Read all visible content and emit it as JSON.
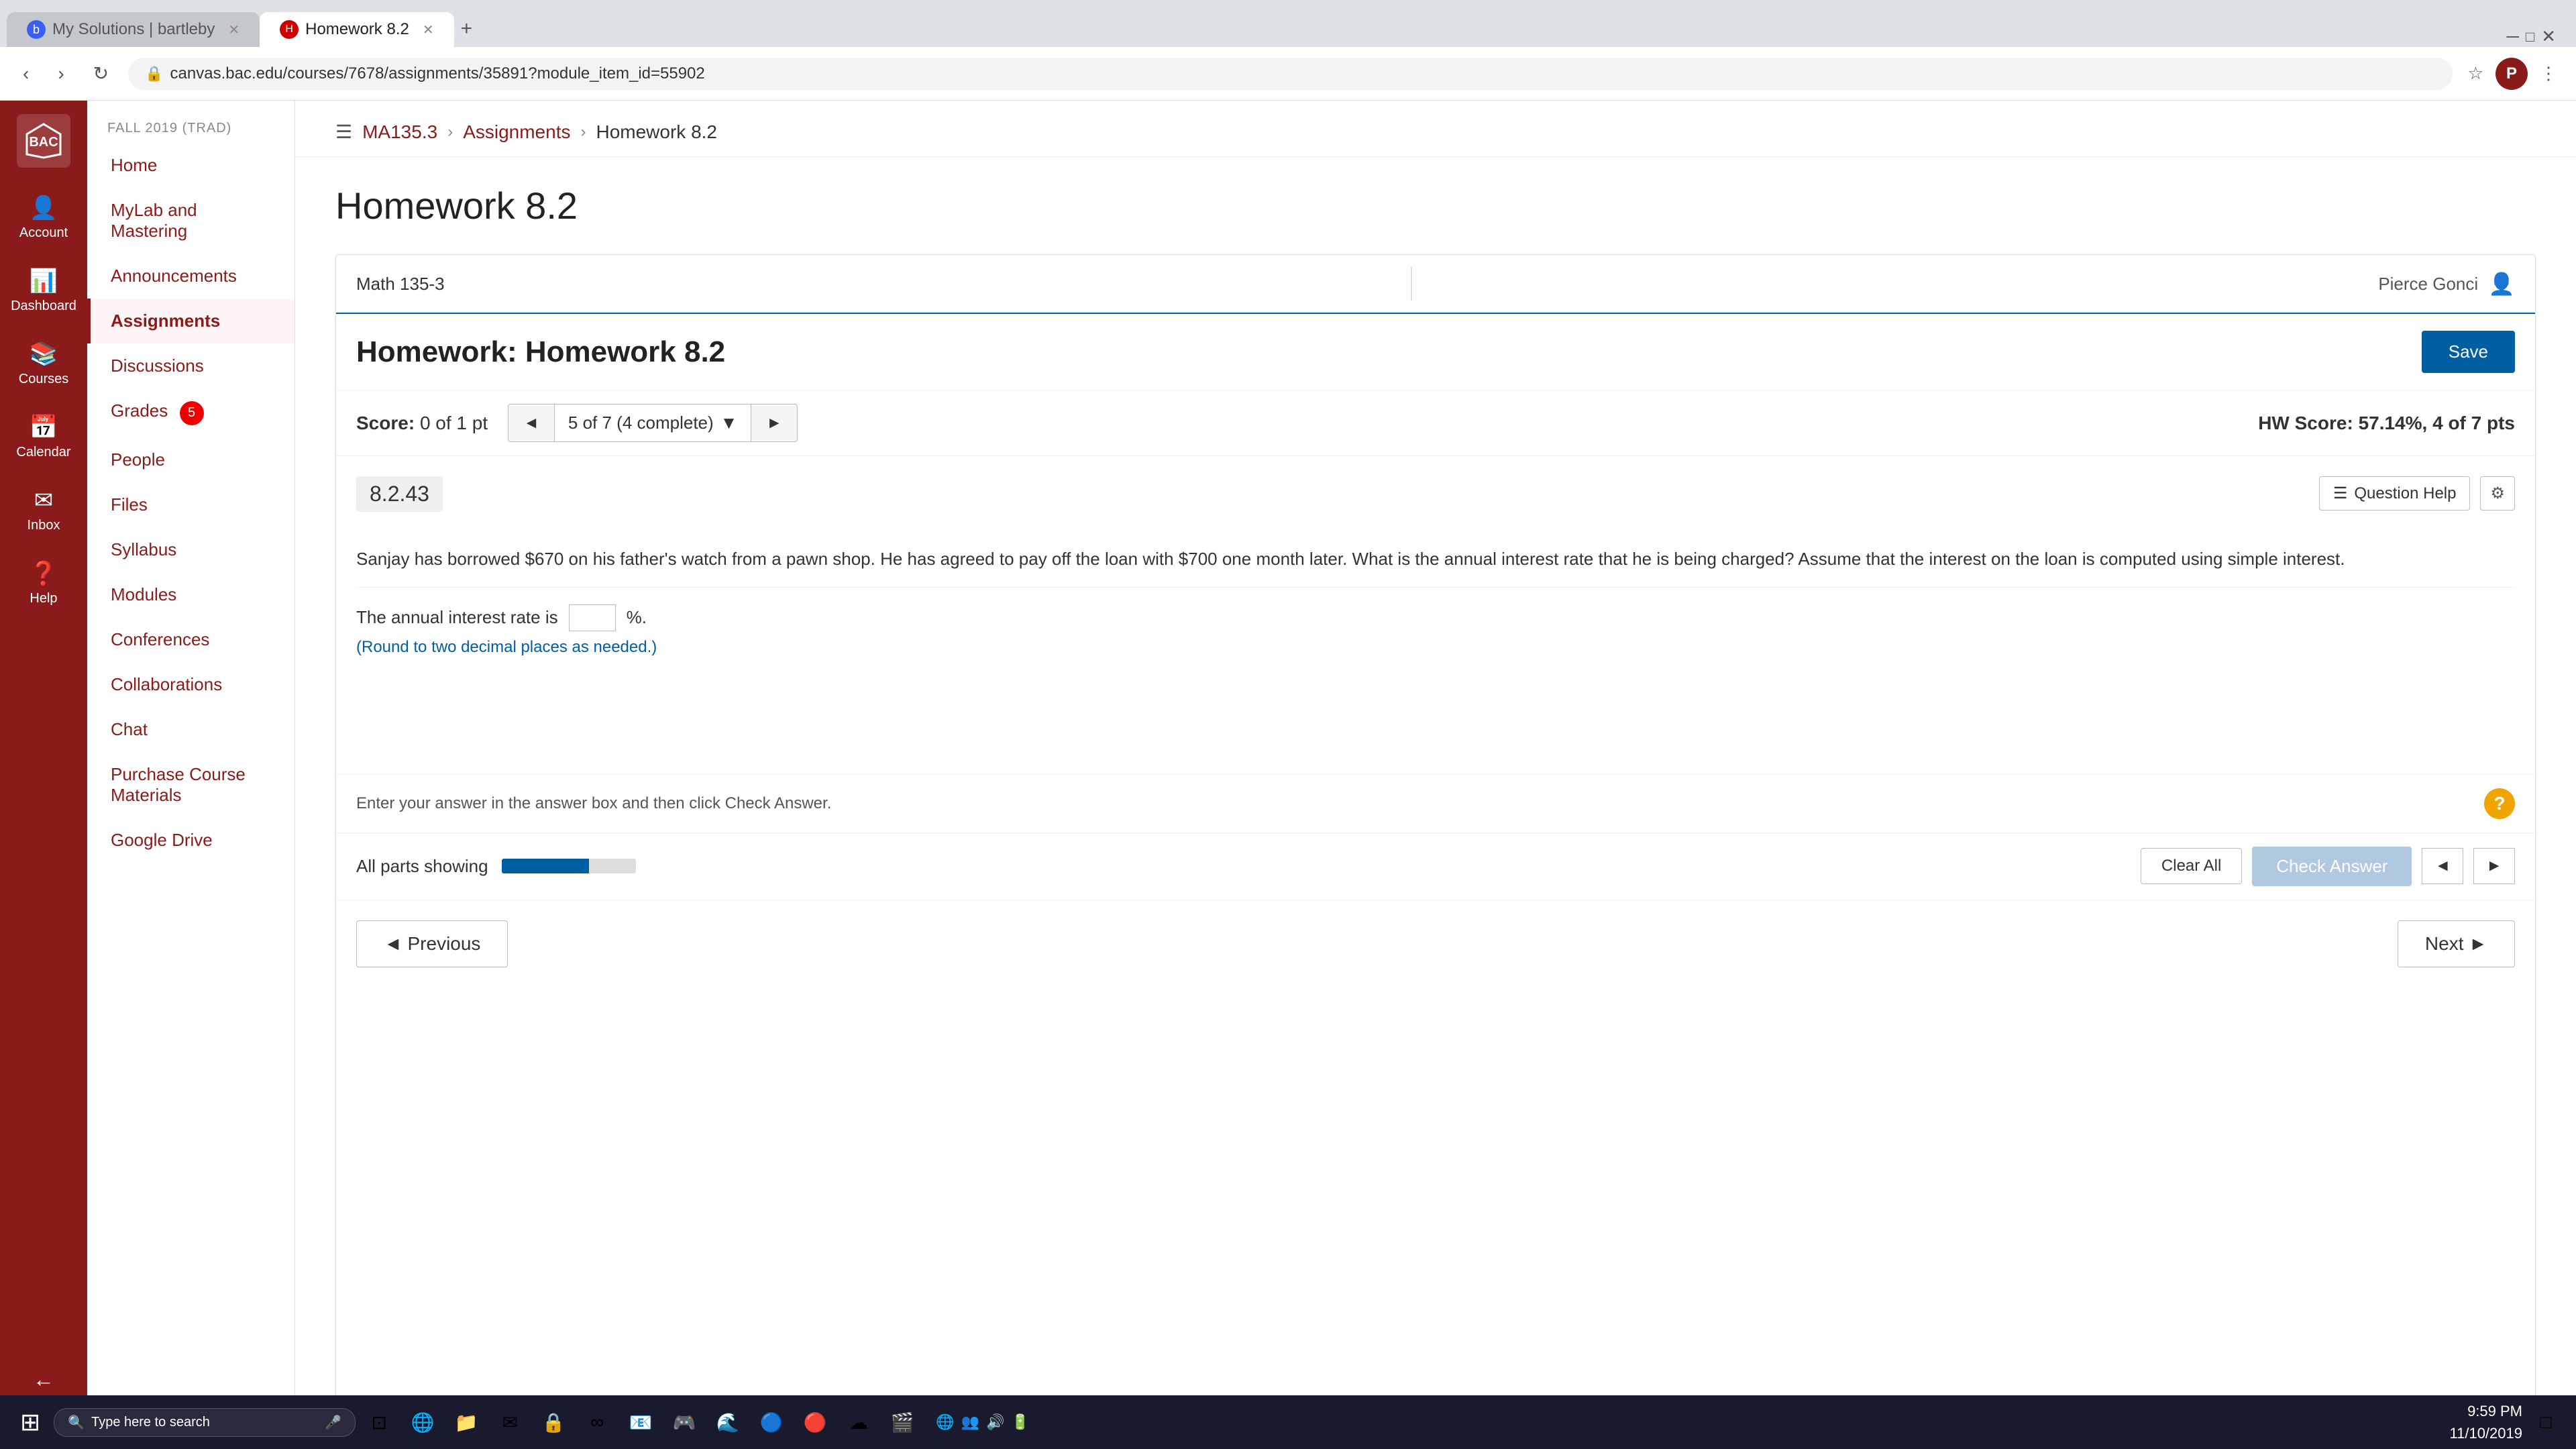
{
  "browser": {
    "tabs": [
      {
        "id": "tab1",
        "label": "My Solutions | bartleby",
        "icon": "b",
        "icon_bg": "#3b5ef5",
        "active": false
      },
      {
        "id": "tab2",
        "label": "Homework 8.2",
        "icon": "H",
        "icon_bg": "#c00",
        "active": true
      }
    ],
    "add_tab_label": "+",
    "nav": {
      "back": "‹",
      "forward": "›",
      "refresh": "↻"
    },
    "address": "canvas.bac.edu/courses/7678/assignments/35891?module_item_id=55902",
    "lock_icon": "🔒",
    "profile_initial": "P"
  },
  "breadcrumb": {
    "menu_icon": "☰",
    "course": "MA135.3",
    "assignments": "Assignments",
    "current": "Homework 8.2"
  },
  "sidebar": {
    "logo_alt": "BAC Logo",
    "items": [
      {
        "id": "account",
        "icon": "👤",
        "label": "Account"
      },
      {
        "id": "dashboard",
        "icon": "📊",
        "label": "Dashboard"
      },
      {
        "id": "courses",
        "icon": "📚",
        "label": "Courses"
      },
      {
        "id": "calendar",
        "icon": "📅",
        "label": "Calendar"
      },
      {
        "id": "inbox",
        "icon": "✉",
        "label": "Inbox"
      },
      {
        "id": "help",
        "icon": "❓",
        "label": "Help"
      }
    ],
    "collapse_icon": "←"
  },
  "course_nav": {
    "label": "FALL 2019 (TRAD)",
    "items": [
      {
        "id": "home",
        "label": "Home",
        "active": false
      },
      {
        "id": "mylab",
        "label": "MyLab and Mastering",
        "active": false
      },
      {
        "id": "announcements",
        "label": "Announcements",
        "active": false
      },
      {
        "id": "assignments",
        "label": "Assignments",
        "active": true
      },
      {
        "id": "discussions",
        "label": "Discussions",
        "active": false
      },
      {
        "id": "grades",
        "label": "Grades",
        "active": false,
        "badge": "5"
      },
      {
        "id": "people",
        "label": "People",
        "active": false
      },
      {
        "id": "files",
        "label": "Files",
        "active": false
      },
      {
        "id": "syllabus",
        "label": "Syllabus",
        "active": false
      },
      {
        "id": "modules",
        "label": "Modules",
        "active": false
      },
      {
        "id": "conferences",
        "label": "Conferences",
        "active": false
      },
      {
        "id": "collaborations",
        "label": "Collaborations",
        "active": false
      },
      {
        "id": "chat",
        "label": "Chat",
        "active": false
      },
      {
        "id": "purchase",
        "label": "Purchase Course Materials",
        "active": false
      },
      {
        "id": "google",
        "label": "Google Drive",
        "active": false
      }
    ]
  },
  "page": {
    "hw_title": "Homework 8.2",
    "mylab_course": "Math 135-3",
    "mylab_user": "Pierce Gonci",
    "mylab_user_icon": "👤",
    "hw_full_title": "Homework: Homework 8.2",
    "save_btn": "Save",
    "score_label": "Score:",
    "score_value": "0 of 1 pt",
    "question_nav": "5 of 7 (4 complete)",
    "hw_score_label": "HW Score:",
    "hw_score_value": "57.14%, 4 of 7 pts",
    "question_number": "8.2.43",
    "question_help_btn": "Question Help",
    "settings_icon": "⚙",
    "question_text": "Sanjay has borrowed $670 on his father's watch from a pawn shop. He has agreed to pay off the loan with $700 one month later. What is the annual interest rate that he is being charged? Assume that the interest on the loan is computed using simple interest.",
    "answer_prompt_before": "The annual interest rate is",
    "answer_placeholder": "",
    "answer_prompt_after": "%.",
    "answer_hint": "(Round to two decimal places as needed.)",
    "answer_instruction": "Enter your answer in the answer box and then click Check Answer.",
    "hint_icon": "?",
    "parts_label": "All parts showing",
    "progress_percent": 65,
    "clear_all_btn": "Clear All",
    "check_answer_btn": "Check Answer",
    "prev_btn": "◄ Previous",
    "next_btn": "Next ►",
    "nav_left": "◄",
    "nav_right": "►"
  },
  "taskbar": {
    "start_icon": "⊞",
    "search_placeholder": "Type here to search",
    "mic_icon": "🎤",
    "time": "9:59 PM",
    "date": "11/10/2019",
    "taskbar_apps": [
      "📁",
      "🌐",
      "📂",
      "🔒",
      "∞",
      "✉",
      "🎮",
      "🌊",
      "🔵",
      "🔴",
      "☁",
      "🎬"
    ]
  }
}
